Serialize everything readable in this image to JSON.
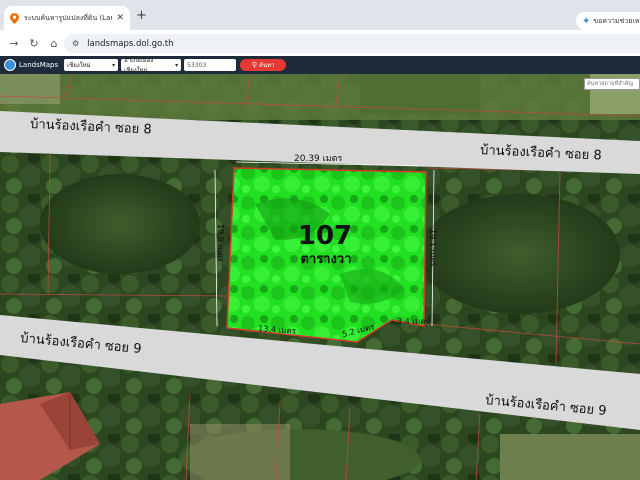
{
  "browser": {
    "tab_title": "ระบบค้นหารูปแปลงที่ดิน (LandsMaps)",
    "tab_close": "✕",
    "new_tab": "+",
    "assist_label": "ขอความช่วยเหลือ",
    "url": "landsmaps.dol.go.th"
  },
  "toolbar": {
    "app_name": "LandsMaps",
    "province": "เชียงใหม่",
    "district": "อำเภอเมืองเชียงใหม่",
    "parcel_number": "53303",
    "search_label": "ค้นหา"
  },
  "map": {
    "search_placeholder": "ค้นหาสถานที่สำคัญ",
    "road_top": "บ้านร้องเรือคำ ซอย 8",
    "road_bottom": "บ้านร้องเรือคำ ซอย 9",
    "parcel_area_value": "107",
    "parcel_area_unit": "ตารางวา",
    "dim_top": "20.39 เมตร",
    "dim_left": "19.8 เมตร",
    "dim_right": "19.1 เมตร",
    "dim_bottom_1": "13.4 เมตร",
    "dim_bottom_2": "5.2 เมตร",
    "dim_bottom_3": "3.4 เมตร"
  },
  "colors": {
    "parcel_fill": "#22e022",
    "parcel_border": "#d33a2c",
    "road": "#d9d9d9",
    "toolbar_bg": "#1d2b3d",
    "search_button": "#e53935"
  }
}
